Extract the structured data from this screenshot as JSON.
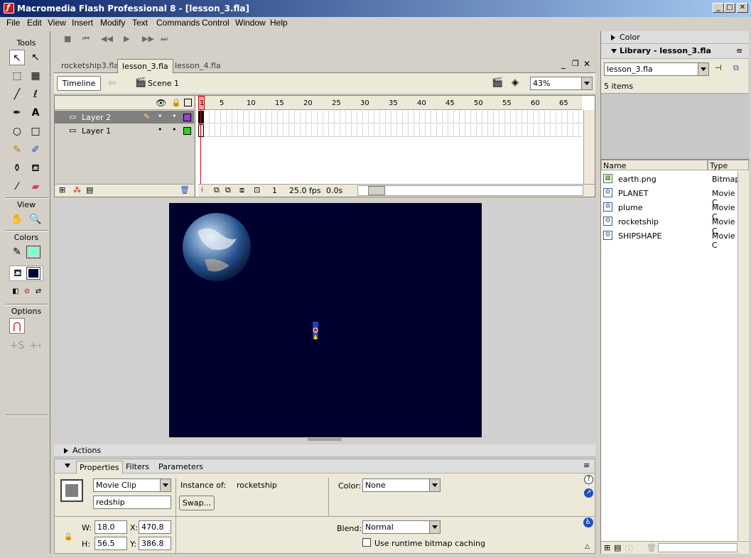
{
  "window": {
    "title": "Macromedia Flash Professional 8 - [lesson_3.fla]"
  },
  "menu": [
    "File",
    "Edit",
    "View",
    "Insert",
    "Modify",
    "Text",
    "Commands",
    "Control",
    "Window",
    "Help"
  ],
  "tools": {
    "label": "Tools",
    "view_label": "View",
    "colors_label": "Colors",
    "options_label": "Options"
  },
  "doc_tabs": [
    "rocketship3.fla",
    "lesson_3.fla",
    "lesson_4.fla"
  ],
  "timeline_bar": {
    "timeline_button": "Timeline",
    "scene": "Scene 1",
    "zoom": "43%"
  },
  "layers": [
    {
      "name": "Layer 2",
      "color": "#9b3fcf"
    },
    {
      "name": "Layer 1",
      "color": "#33cc33"
    }
  ],
  "ruler_numbers": [
    "1",
    "5",
    "10",
    "15",
    "20",
    "25",
    "30",
    "35",
    "40",
    "45",
    "50",
    "55",
    "60",
    "65"
  ],
  "timeline_status": {
    "frame": "1",
    "fps": "25.0 fps",
    "time": "0.0s"
  },
  "actions_label": "Actions",
  "properties": {
    "tabs": [
      "Properties",
      "Filters",
      "Parameters"
    ],
    "symbol_type": "Movie Clip",
    "instance_name": "redship",
    "instance_of_label": "Instance of:",
    "instance_of": "rocketship",
    "swap_label": "Swap...",
    "color_label": "Color:",
    "color_value": "None",
    "w_label": "W:",
    "w": "18.0",
    "h_label": "H:",
    "h": "56.5",
    "x_label": "X:",
    "x": "470.8",
    "y_label": "Y:",
    "y": "386.8",
    "blend_label": "Blend:",
    "blend": "Normal",
    "cache_label": "Use runtime bitmap caching"
  },
  "color_panel_label": "Color",
  "library": {
    "title": "Library - lesson_3.fla",
    "doc": "lesson_3.fla",
    "count": "5 items",
    "col_name": "Name",
    "col_type": "Type",
    "items": [
      {
        "name": "earth.png",
        "type": "Bitmap",
        "icon": "bitmap-icon"
      },
      {
        "name": "PLANET",
        "type": "Movie C",
        "icon": "movieclip-icon"
      },
      {
        "name": "plume",
        "type": "Movie C",
        "icon": "movieclip-icon"
      },
      {
        "name": "rocketship",
        "type": "Movie C",
        "icon": "movieclip-icon"
      },
      {
        "name": "SHIPSHAPE",
        "type": "Movie C",
        "icon": "movieclip-icon"
      }
    ]
  },
  "colors": {
    "stroke": "#7fffd4",
    "fill": "#000033",
    "stage": "#00002e"
  }
}
